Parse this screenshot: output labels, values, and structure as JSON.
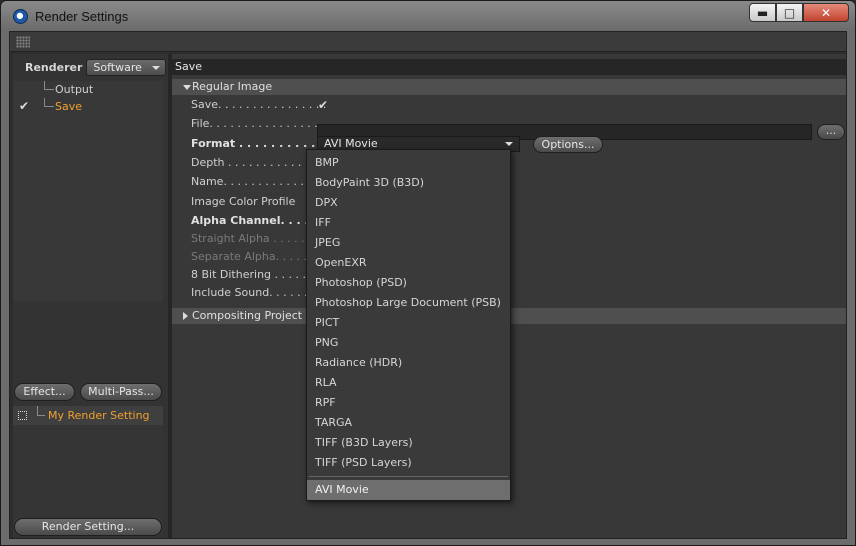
{
  "window": {
    "title": "Render Settings",
    "min_label": "▬",
    "max_label": "□",
    "close_label": "✕"
  },
  "left": {
    "renderer_label": "Renderer",
    "renderer_value": "Software",
    "tree": [
      {
        "label": "Output",
        "checked": false
      },
      {
        "label": "Save",
        "checked": true
      }
    ],
    "check_mark": "✔",
    "effect_button": "Effect...",
    "multipass_button": "Multi-Pass...",
    "render_setting_item": "My Render Setting",
    "render_setting_button": "Render Setting..."
  },
  "right": {
    "section_title": "Save",
    "group_regular": "Regular Image",
    "props": {
      "save": "Save. . . . . . . . . . . . . . . .",
      "file": "File. . . . . . . . . . . . . . . . .",
      "format": "Format . . . . . . . . . . . .",
      "depth": "Depth . . . . . . . . . . . . . . .",
      "name": "Name. . . . . . . . . . . . . . .",
      "color_profile": "Image Color Profile",
      "alpha_channel": "Alpha Channel. . . . .",
      "straight_alpha": "Straight Alpha . . . . . .",
      "separate_alpha": "Separate Alpha. . . . . .",
      "dithering": "8 Bit Dithering . . . . . .",
      "include_sound": "Include Sound. . . . . . ."
    },
    "save_check": "✔",
    "file_browse": "...",
    "format_value": "AVI Movie",
    "options_button": "Options...",
    "group_compositing": "Compositing Project F"
  },
  "format_options": [
    "BMP",
    "BodyPaint 3D (B3D)",
    "DPX",
    "IFF",
    "JPEG",
    "OpenEXR",
    "Photoshop (PSD)",
    "Photoshop Large Document (PSB)",
    "PICT",
    "PNG",
    "Radiance (HDR)",
    "RLA",
    "RPF",
    "TARGA",
    "TIFF (B3D Layers)",
    "TIFF (PSD Layers)"
  ],
  "format_selected": "AVI Movie",
  "colors": {
    "highlight": "#f0a030",
    "panel": "#383838",
    "selected_item": "#6e6e6e"
  }
}
